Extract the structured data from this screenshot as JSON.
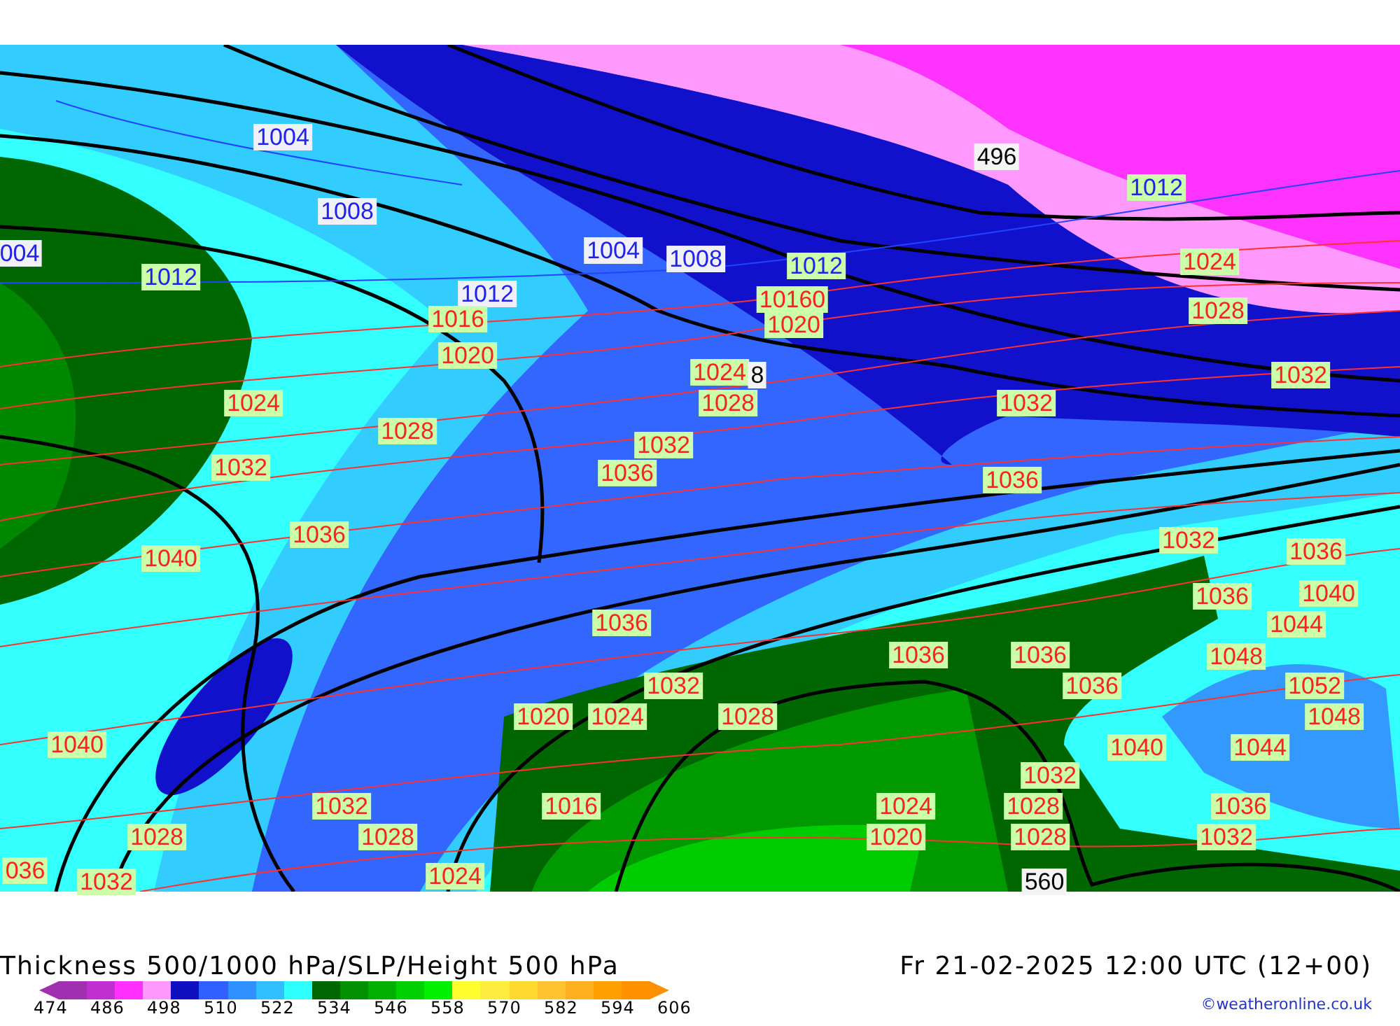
{
  "map": {
    "labels": [
      {
        "text": "1004",
        "kind": "low"
      },
      {
        "text": "496",
        "kind": "height"
      },
      {
        "text": "1012",
        "kind": "low-green"
      },
      {
        "text": "1008",
        "kind": "low"
      },
      {
        "text": "004",
        "kind": "low"
      },
      {
        "text": "1012",
        "kind": "low-green"
      },
      {
        "text": "1012",
        "kind": "low"
      },
      {
        "text": "1004",
        "kind": "low"
      },
      {
        "text": "1008",
        "kind": "low"
      },
      {
        "text": "1012",
        "kind": "low-green"
      },
      {
        "text": "1024",
        "kind": "high"
      },
      {
        "text": "1016",
        "kind": "high"
      },
      {
        "text": "10160",
        "kind": "high"
      },
      {
        "text": "1020",
        "kind": "high"
      },
      {
        "text": "1028",
        "kind": "high"
      },
      {
        "text": "1020",
        "kind": "high"
      },
      {
        "text": "1024",
        "kind": "high"
      },
      {
        "text": "8",
        "kind": "height"
      },
      {
        "text": "1032",
        "kind": "high"
      },
      {
        "text": "1024",
        "kind": "high"
      },
      {
        "text": "1028",
        "kind": "high"
      },
      {
        "text": "1032",
        "kind": "high"
      },
      {
        "text": "1028",
        "kind": "high"
      },
      {
        "text": "1032",
        "kind": "high"
      },
      {
        "text": "1032",
        "kind": "high"
      },
      {
        "text": "1036",
        "kind": "high"
      },
      {
        "text": "1036",
        "kind": "high"
      },
      {
        "text": "1040",
        "kind": "high"
      },
      {
        "text": "1036",
        "kind": "high"
      },
      {
        "text": "1032",
        "kind": "high"
      },
      {
        "text": "1036",
        "kind": "high"
      },
      {
        "text": "1036",
        "kind": "high"
      },
      {
        "text": "1040",
        "kind": "high"
      },
      {
        "text": "1036",
        "kind": "high"
      },
      {
        "text": "1044",
        "kind": "high"
      },
      {
        "text": "1036",
        "kind": "high"
      },
      {
        "text": "1036",
        "kind": "high"
      },
      {
        "text": "1048",
        "kind": "high"
      },
      {
        "text": "1032",
        "kind": "high"
      },
      {
        "text": "1036",
        "kind": "high"
      },
      {
        "text": "1052",
        "kind": "high"
      },
      {
        "text": "1020",
        "kind": "high"
      },
      {
        "text": "1024",
        "kind": "high"
      },
      {
        "text": "1028",
        "kind": "high"
      },
      {
        "text": "1048",
        "kind": "high"
      },
      {
        "text": "1040",
        "kind": "high"
      },
      {
        "text": "1040",
        "kind": "high"
      },
      {
        "text": "1044",
        "kind": "high"
      },
      {
        "text": "1032",
        "kind": "high"
      },
      {
        "text": "1032",
        "kind": "high"
      },
      {
        "text": "1016",
        "kind": "high"
      },
      {
        "text": "1024",
        "kind": "high"
      },
      {
        "text": "1028",
        "kind": "high"
      },
      {
        "text": "1036",
        "kind": "high"
      },
      {
        "text": "1028",
        "kind": "high"
      },
      {
        "text": "1028",
        "kind": "high"
      },
      {
        "text": "1020",
        "kind": "high"
      },
      {
        "text": "1028",
        "kind": "high"
      },
      {
        "text": "1032",
        "kind": "high"
      },
      {
        "text": "036",
        "kind": "high"
      },
      {
        "text": "1032",
        "kind": "high"
      },
      {
        "text": "1024",
        "kind": "high"
      },
      {
        "text": "560",
        "kind": "height"
      }
    ]
  },
  "title": "Thickness 500/1000 hPa/SLP/Height 500 hPa",
  "valid_time": "Fr 21-02-2025 12:00 UTC (12+00)",
  "legend": {
    "swatches": [
      {
        "color": "#a030b0"
      },
      {
        "color": "#c030d0"
      },
      {
        "color": "#ff30ff"
      },
      {
        "color": "#ff99ff"
      },
      {
        "color": "#1010c0"
      },
      {
        "color": "#3060ff"
      },
      {
        "color": "#3090ff"
      },
      {
        "color": "#30c0ff"
      },
      {
        "color": "#30ffff"
      },
      {
        "color": "#006600"
      },
      {
        "color": "#009000"
      },
      {
        "color": "#00b000"
      },
      {
        "color": "#00d000"
      },
      {
        "color": "#00f000"
      },
      {
        "color": "#ffff30"
      },
      {
        "color": "#ffec40"
      },
      {
        "color": "#ffd830"
      },
      {
        "color": "#ffc430"
      },
      {
        "color": "#ffb020"
      },
      {
        "color": "#ffa000"
      },
      {
        "color": "#ff9000"
      }
    ],
    "ticks": [
      "474",
      "486",
      "498",
      "510",
      "522",
      "534",
      "546",
      "558",
      "570",
      "582",
      "594",
      "606"
    ]
  },
  "credit": "©weatheronline.co.uk"
}
